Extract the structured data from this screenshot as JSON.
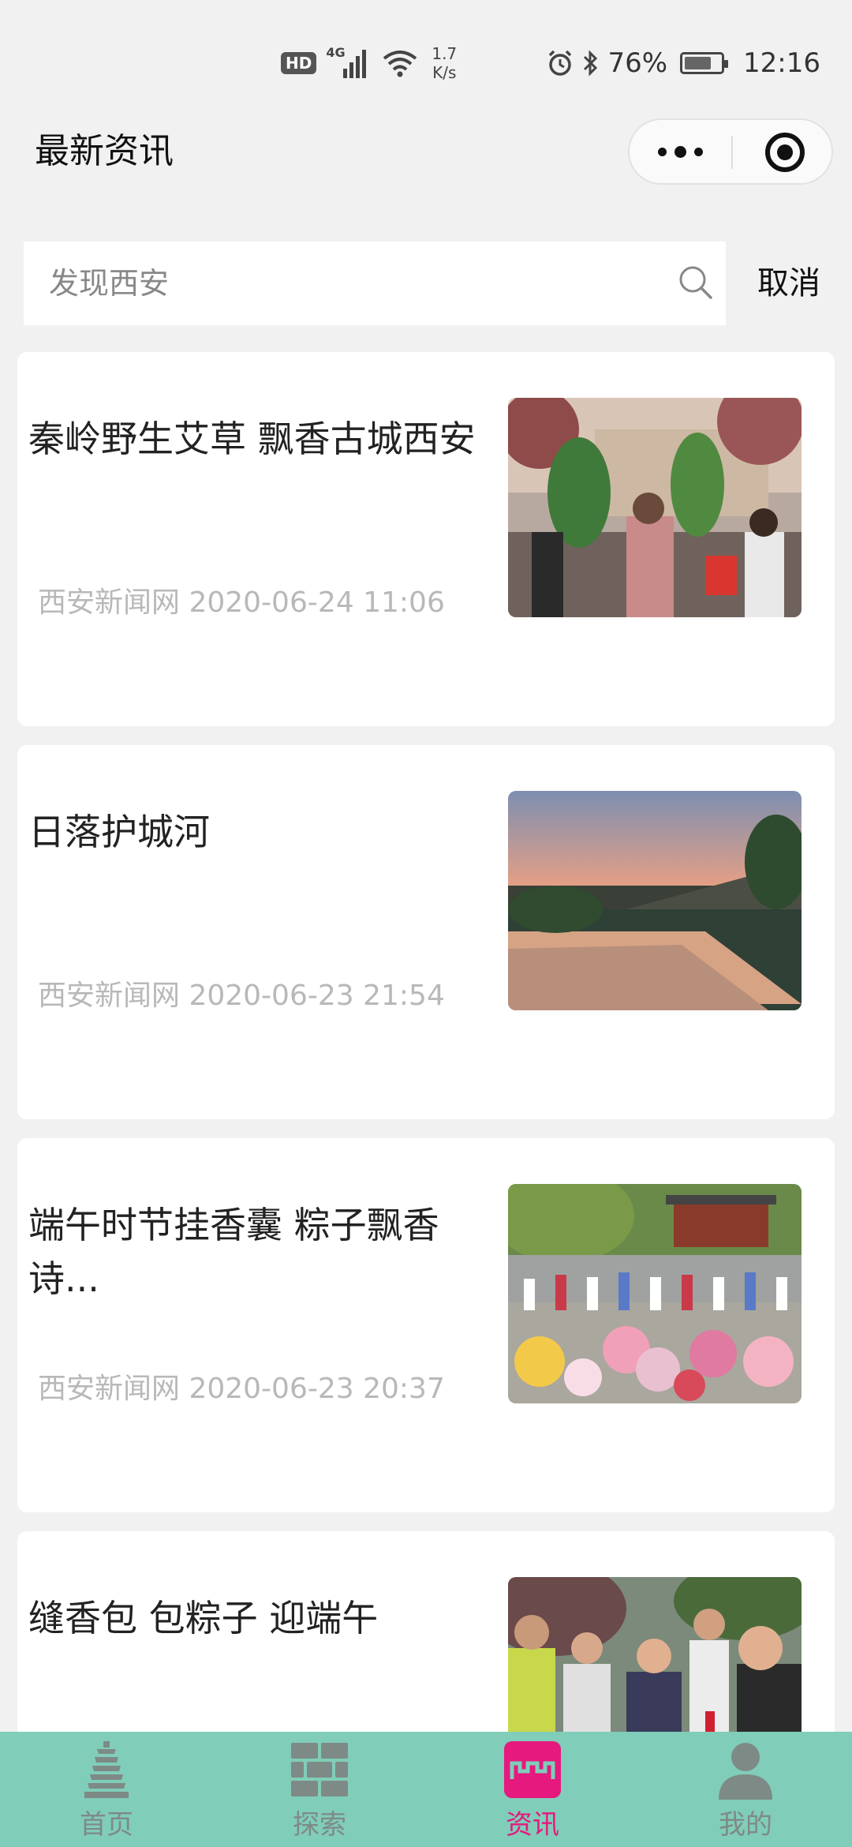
{
  "status_bar": {
    "hd": "HD",
    "network": "4G",
    "speed_value": "1.7",
    "speed_unit": "K/s",
    "battery": "76%",
    "battery_level": 0.76,
    "time": "12:16"
  },
  "nav": {
    "title": "最新资讯"
  },
  "search": {
    "placeholder": "发现西安",
    "cancel_label": "取消"
  },
  "news": [
    {
      "title": "秦岭野生艾草 飘香古城西安",
      "meta": "西安新闻网 2020-06-24 11:06"
    },
    {
      "title": "日落护城河",
      "meta": "西安新闻网 2020-06-23 21:54"
    },
    {
      "title": "端午时节挂香囊 粽子飘香诗...",
      "meta": "西安新闻网 2020-06-23 20:37"
    },
    {
      "title": "缝香包 包粽子 迎端午",
      "meta": ""
    }
  ],
  "tabs": [
    {
      "label": "首页",
      "icon": "pagoda-icon",
      "active": false
    },
    {
      "label": "探索",
      "icon": "wall-icon",
      "active": false
    },
    {
      "label": "资讯",
      "icon": "news-icon",
      "active": true
    },
    {
      "label": "我的",
      "icon": "user-icon",
      "active": false
    }
  ],
  "colors": {
    "tabbar_bg": "#80cdb9",
    "tab_active": "#e5197e",
    "tab_inactive": "#7e8a86"
  }
}
